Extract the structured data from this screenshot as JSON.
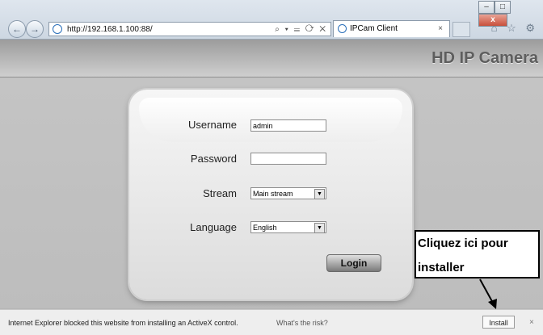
{
  "browser": {
    "address_url": "http://192.168.1.100:88/",
    "address_tools": "⌕ ▾ ☰ ⟳ ✕",
    "tab_title": "IPCam Client",
    "tab_close": "×",
    "window": {
      "minimize": "–",
      "maximize": "□",
      "close": "x"
    },
    "toolbar_icons": "⌂ ☆ ⚙"
  },
  "header": {
    "brand": "HD IP Camera"
  },
  "login_form": {
    "username_label": "Username",
    "username_value": "admin",
    "password_label": "Password",
    "password_value": "",
    "stream_label": "Stream",
    "stream_value": "Main stream",
    "language_label": "Language",
    "language_value": "English",
    "login_button": "Login"
  },
  "annotation": {
    "line1": "Cliquez ici pour",
    "line2": "installer"
  },
  "infobar": {
    "message": "Internet Explorer blocked this website from installing an ActiveX control.",
    "risk_link": "What's the risk?",
    "install_button": "Install",
    "close": "×"
  }
}
